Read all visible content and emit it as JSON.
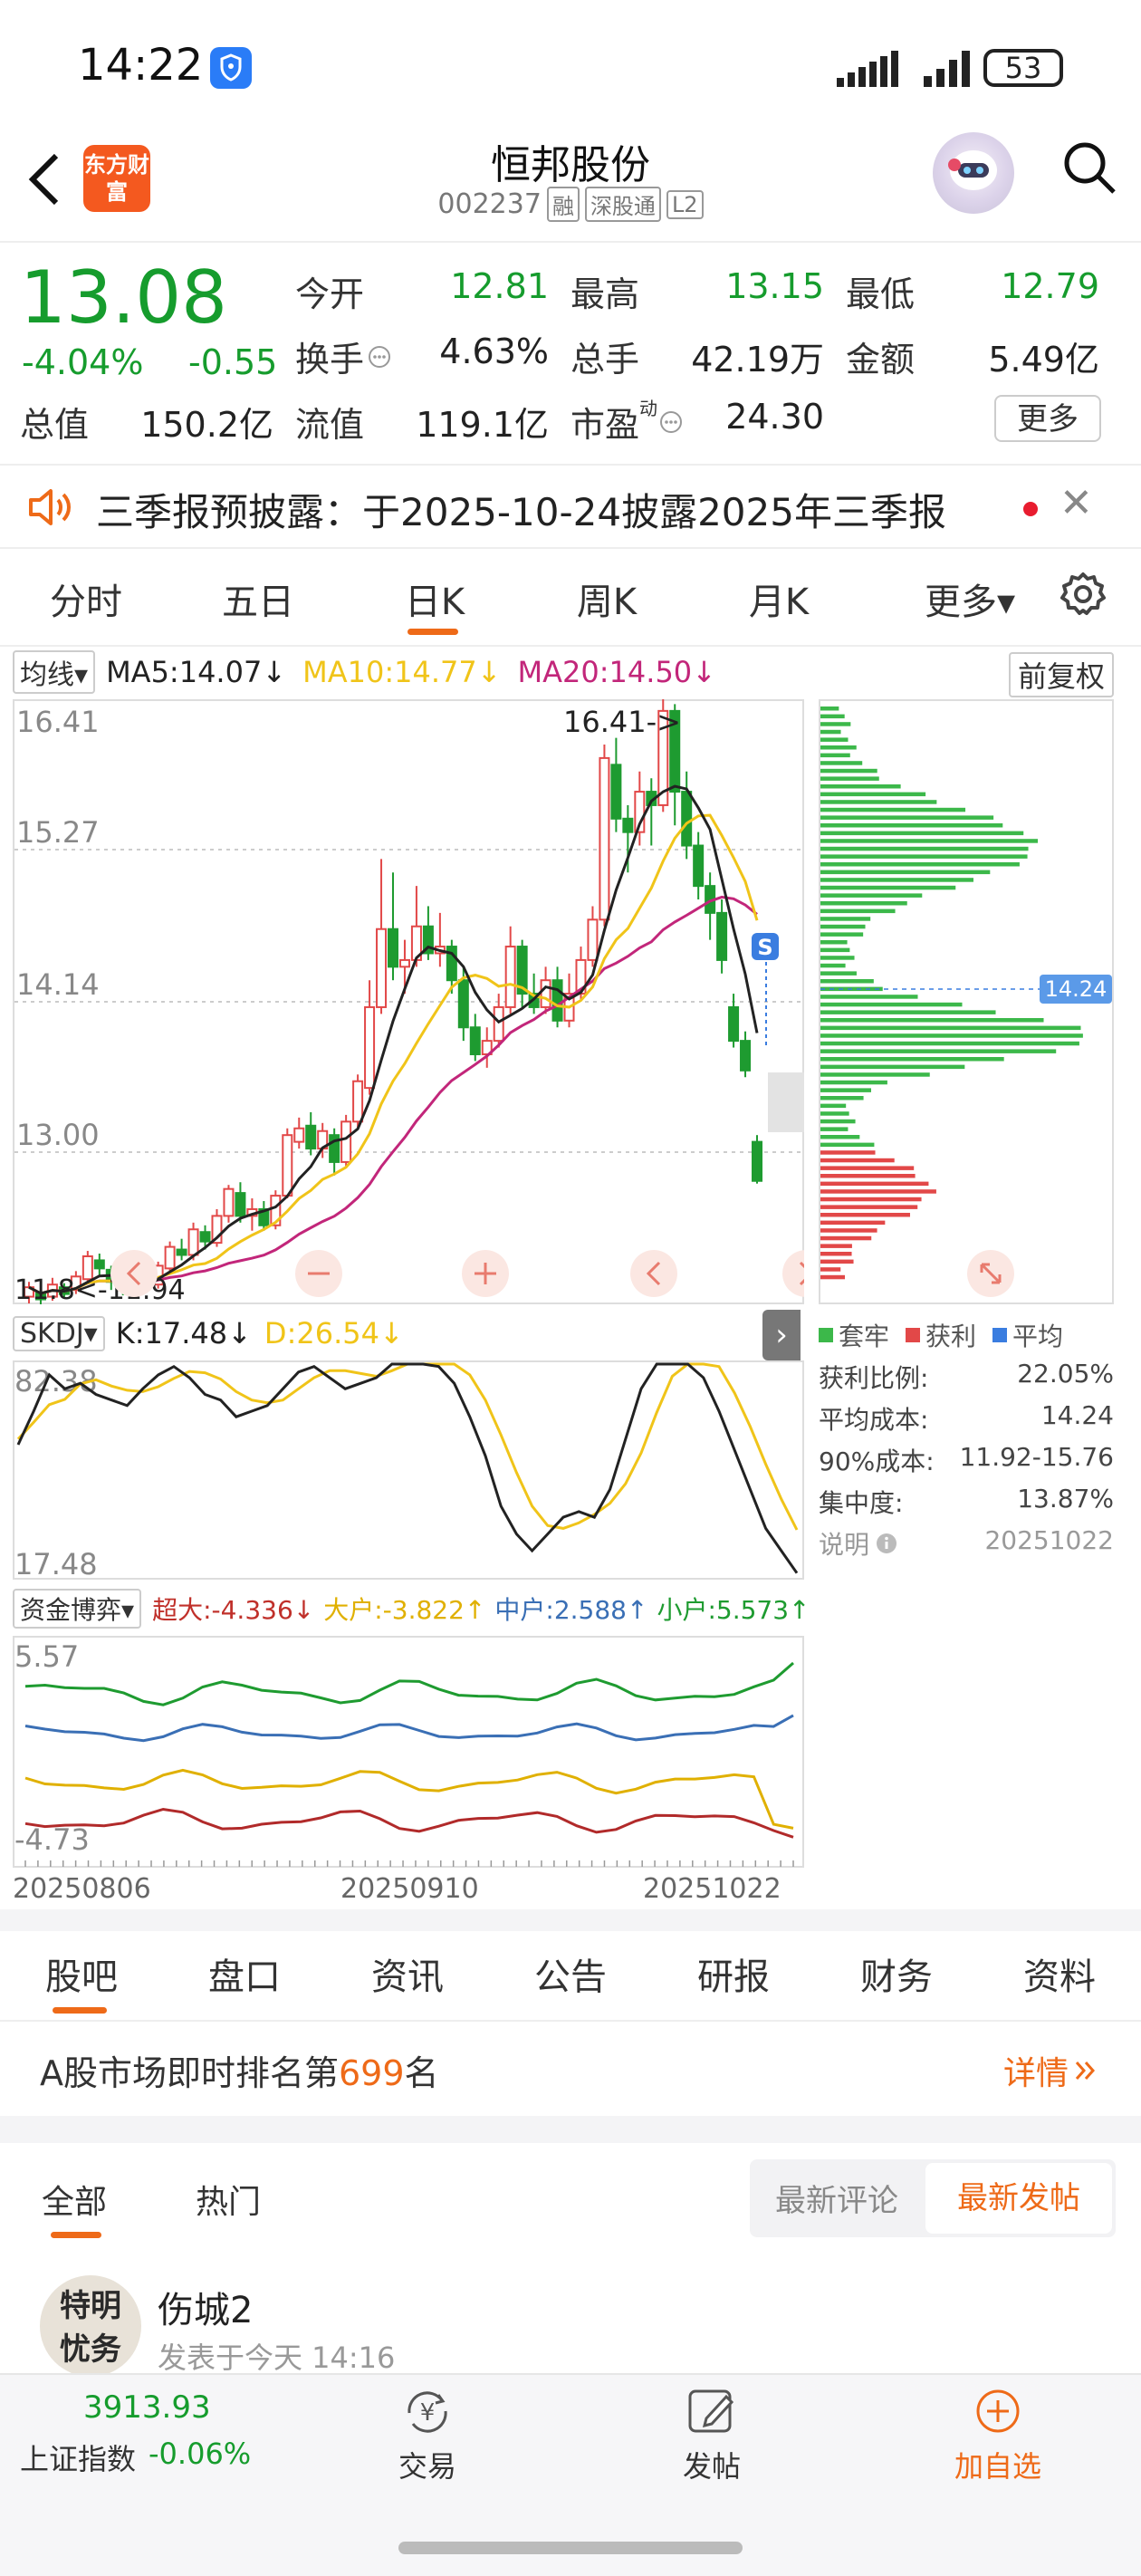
{
  "status": {
    "time": "14:22",
    "battery": "53"
  },
  "header": {
    "logo_text": "东方财富",
    "stock_name": "恒邦股份",
    "stock_code": "002237",
    "tags": [
      "融",
      "深股通",
      "L2"
    ]
  },
  "quote": {
    "price": "13.08",
    "change_pct": "-4.04%",
    "change_amt": "-0.55",
    "fields": [
      {
        "label": "今开",
        "value": "12.81",
        "color": "#169c2d"
      },
      {
        "label": "最高",
        "value": "13.15",
        "color": "#169c2d"
      },
      {
        "label": "最低",
        "value": "12.79",
        "color": "#169c2d"
      },
      {
        "label": "换手",
        "value": "4.63%",
        "color": "#333333"
      },
      {
        "label": "总手",
        "value": "42.19万",
        "color": "#333333"
      },
      {
        "label": "金额",
        "value": "5.49亿",
        "color": "#333333"
      },
      {
        "label": "总值",
        "value": "150.2亿",
        "color": "#333333"
      },
      {
        "label": "流值",
        "value": "119.1亿",
        "color": "#333333"
      },
      {
        "label": "市盈",
        "value": "24.30",
        "color": "#333333"
      }
    ],
    "pe_superscript": "动",
    "more": "更多"
  },
  "notice": {
    "text": "三季报预披露：于2025-10-24披露2025年三季报"
  },
  "period_tabs": [
    "分时",
    "五日",
    "日K",
    "周K",
    "月K",
    "更多▾"
  ],
  "active_period": "日K",
  "ma_legend": {
    "selector": "均线▾",
    "ma5": "MA5:14.07↓",
    "ma10": "MA10:14.77↓",
    "ma20": "MA20:14.50↓",
    "adjust": "前复权"
  },
  "kline": {
    "y_labels": [
      "16.41",
      "15.27",
      "14.14",
      "13.00"
    ],
    "high_marker": "16.41->",
    "low_marker": "11.8<-11.94",
    "last_label": "14.24",
    "s_badge": "S"
  },
  "kdj": {
    "selector": "SKDJ▾",
    "k": "K:17.48↓",
    "d": "D:26.54↓",
    "y_top": "82.38",
    "y_bottom": "17.48"
  },
  "fund": {
    "selector": "资金博弈▾",
    "super": "超大:-4.336↓",
    "large": "大户:-3.822↑",
    "mid": "中户:2.588↑",
    "small": "小户:5.573↑",
    "y_top": "5.57",
    "y_bottom": "-4.73"
  },
  "dates": [
    "20250806",
    "20250910",
    "20251022"
  ],
  "chip": {
    "legend": [
      "套牢",
      "获利",
      "平均"
    ],
    "colors": {
      "trapped": "#3cb84a",
      "profit": "#e24848",
      "avg": "#3a7de0"
    },
    "stats": [
      {
        "label": "获利比例:",
        "value": "22.05%"
      },
      {
        "label": "平均成本:",
        "value": "14.24"
      },
      {
        "label": "90%成本:",
        "value": "11.92-15.76"
      },
      {
        "label": "集中度:",
        "value": "13.87%"
      }
    ],
    "note_label": "说明",
    "note_date": "20251022"
  },
  "content_tabs": [
    "股吧",
    "盘口",
    "资讯",
    "公告",
    "研报",
    "财务",
    "资料"
  ],
  "rank": {
    "prefix": "A股市场即时排名第",
    "number": "699",
    "suffix": "名",
    "detail": "详情"
  },
  "feed_tabs": [
    "全部",
    "热门"
  ],
  "sort": {
    "comment": "最新评论",
    "post": "最新发帖"
  },
  "post": {
    "avatar_text": "特明 忧务",
    "user": "伤城2",
    "time": "发表于今天 14:16"
  },
  "bottom": {
    "index_value": "3913.93",
    "index_name": "上证指数",
    "index_change": "-0.06%",
    "nav": [
      "交易",
      "发帖",
      "加自选"
    ]
  }
}
